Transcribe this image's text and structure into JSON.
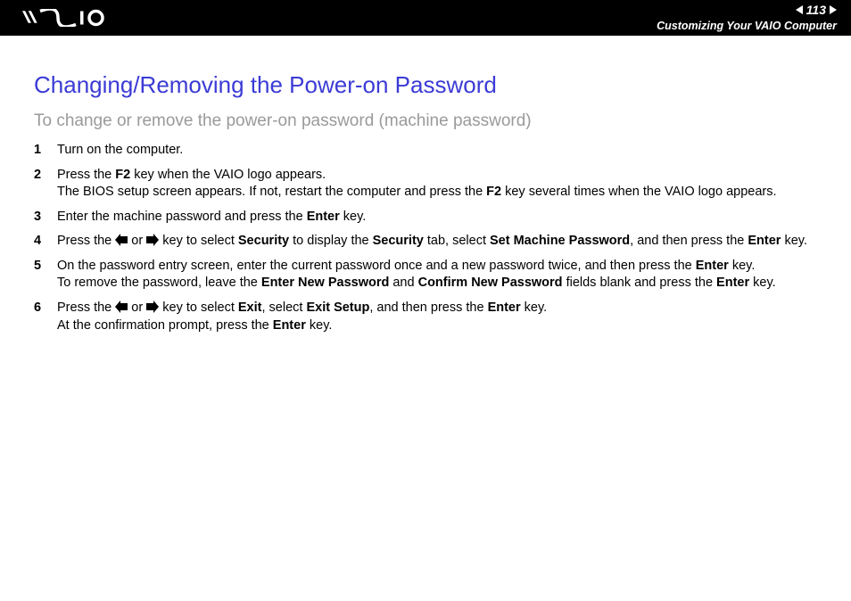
{
  "header": {
    "page_number": "113",
    "breadcrumb": "Customizing Your VAIO Computer"
  },
  "title": "Changing/Removing the Power-on Password",
  "subtitle": "To change or remove the power-on password (machine password)",
  "steps": [
    {
      "num": "1",
      "segments": [
        {
          "t": "Turn on the computer."
        }
      ]
    },
    {
      "num": "2",
      "segments": [
        {
          "t": "Press the "
        },
        {
          "t": "F2",
          "b": true
        },
        {
          "t": " key when the VAIO logo appears."
        },
        {
          "br": true
        },
        {
          "t": "The BIOS setup screen appears. If not, restart the computer and press the "
        },
        {
          "t": "F2",
          "b": true
        },
        {
          "t": " key several times when the VAIO logo appears."
        }
      ]
    },
    {
      "num": "3",
      "segments": [
        {
          "t": "Enter the machine password and press the "
        },
        {
          "t": "Enter",
          "b": true
        },
        {
          "t": " key."
        }
      ]
    },
    {
      "num": "4",
      "segments": [
        {
          "t": "Press the "
        },
        {
          "icon": "arrow-left"
        },
        {
          "t": " or "
        },
        {
          "icon": "arrow-right"
        },
        {
          "t": " key to select "
        },
        {
          "t": "Security",
          "b": true
        },
        {
          "t": " to display the "
        },
        {
          "t": "Security",
          "b": true
        },
        {
          "t": " tab, select "
        },
        {
          "t": "Set Machine Password",
          "b": true
        },
        {
          "t": ", and then press the "
        },
        {
          "t": "Enter",
          "b": true
        },
        {
          "t": " key."
        }
      ]
    },
    {
      "num": "5",
      "segments": [
        {
          "t": "On the password entry screen, enter the current password once and a new password twice, and then press the "
        },
        {
          "t": "Enter",
          "b": true
        },
        {
          "t": " key."
        },
        {
          "br": true
        },
        {
          "t": "To remove the password, leave the "
        },
        {
          "t": "Enter New Password",
          "b": true
        },
        {
          "t": " and "
        },
        {
          "t": "Confirm New Password",
          "b": true
        },
        {
          "t": " fields blank and press the "
        },
        {
          "t": "Enter",
          "b": true
        },
        {
          "t": " key."
        }
      ]
    },
    {
      "num": "6",
      "segments": [
        {
          "t": "Press the "
        },
        {
          "icon": "arrow-left"
        },
        {
          "t": " or "
        },
        {
          "icon": "arrow-right"
        },
        {
          "t": " key to select "
        },
        {
          "t": "Exit",
          "b": true
        },
        {
          "t": ", select "
        },
        {
          "t": "Exit Setup",
          "b": true
        },
        {
          "t": ", and then press the "
        },
        {
          "t": "Enter",
          "b": true
        },
        {
          "t": " key."
        },
        {
          "br": true
        },
        {
          "t": "At the confirmation prompt, press the "
        },
        {
          "t": "Enter",
          "b": true
        },
        {
          "t": " key."
        }
      ]
    }
  ]
}
